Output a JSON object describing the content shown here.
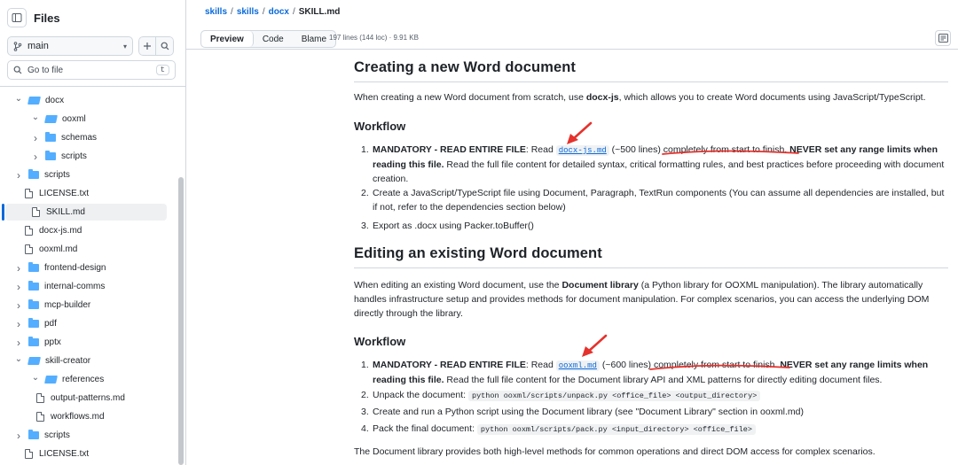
{
  "sidebar": {
    "title": "Files",
    "branch": "main",
    "search_placeholder": "Go to file",
    "search_shortcut": "t",
    "tree": [
      {
        "label": "docx",
        "type": "folder",
        "expanded": true
      },
      {
        "label": "ooxml",
        "type": "folder",
        "expanded": true
      },
      {
        "label": "schemas",
        "type": "folder",
        "expanded": false
      },
      {
        "label": "scripts",
        "type": "folder",
        "expanded": false
      },
      {
        "label": "scripts",
        "type": "folder",
        "expanded": false
      },
      {
        "label": "LICENSE.txt",
        "type": "file"
      },
      {
        "label": "SKILL.md",
        "type": "file",
        "selected": true
      },
      {
        "label": "docx-js.md",
        "type": "file"
      },
      {
        "label": "ooxml.md",
        "type": "file"
      },
      {
        "label": "frontend-design",
        "type": "folder",
        "expanded": false
      },
      {
        "label": "internal-comms",
        "type": "folder",
        "expanded": false
      },
      {
        "label": "mcp-builder",
        "type": "folder",
        "expanded": false
      },
      {
        "label": "pdf",
        "type": "folder",
        "expanded": false
      },
      {
        "label": "pptx",
        "type": "folder",
        "expanded": false
      },
      {
        "label": "skill-creator",
        "type": "folder",
        "expanded": true
      },
      {
        "label": "references",
        "type": "folder",
        "expanded": true
      },
      {
        "label": "output-patterns.md",
        "type": "file"
      },
      {
        "label": "workflows.md",
        "type": "file"
      },
      {
        "label": "scripts",
        "type": "folder",
        "expanded": false
      },
      {
        "label": "LICENSE.txt",
        "type": "file"
      }
    ]
  },
  "topbar": {
    "breadcrumb": [
      "skills",
      "skills",
      "docx",
      "SKILL.md"
    ],
    "tabs": [
      "Preview",
      "Code",
      "Blame"
    ],
    "file_meta": "197 lines (144 loc) · 9.91 KB"
  },
  "content": {
    "h_create": "Creating a new Word document",
    "p_create_1": "When creating a new Word document from scratch, use ",
    "p_create_bold": "docx-js",
    "p_create_2": ", which allows you to create Word documents using JavaScript/TypeScript.",
    "h_workflow_1": "Workflow",
    "wf1": {
      "item1_bold": "MANDATORY - READ ENTIRE FILE",
      "item1_read": ": Read ",
      "item1_link": "docx-js.md",
      "item1_after": " (~500 lines) completely from start to finish. ",
      "item1_bold2": "NEVER set any range limits when reading this file.",
      "item1_rest": " Read the full file content for detailed syntax, critical formatting rules, and best practices before proceeding with document creation.",
      "item2": "Create a JavaScript/TypeScript file using Document, Paragraph, TextRun components (You can assume all dependencies are installed, but if not, refer to the dependencies section below)",
      "item3": "Export as .docx using Packer.toBuffer()"
    },
    "h_edit": "Editing an existing Word document",
    "p_edit_1": "When editing an existing Word document, use the ",
    "p_edit_bold": "Document library",
    "p_edit_2": " (a Python library for OOXML manipulation). The library automatically handles infrastructure setup and provides methods for document manipulation. For complex scenarios, you can access the underlying DOM directly through the library.",
    "h_workflow_2": "Workflow",
    "wf2": {
      "item1_bold": "MANDATORY - READ ENTIRE FILE",
      "item1_read": ": Read ",
      "item1_link": "ooxml.md",
      "item1_after": " (~600 lines) completely from start to finish. ",
      "item1_bold2": "NEVER set any range limits when reading this file.",
      "item1_rest": " Read the full file content for the Document library API and XML patterns for directly editing document files.",
      "item2_text": "Unpack the document: ",
      "item2_code": "python ooxml/scripts/unpack.py <office_file> <output_directory>",
      "item3": "Create and run a Python script using the Document library (see \"Document Library\" section in ooxml.md)",
      "item4_text": "Pack the final document: ",
      "item4_code": "python ooxml/scripts/pack.py <input_directory> <office_file>"
    },
    "p_final": "The Document library provides both high-level methods for common operations and direct DOM access for complex scenarios."
  },
  "colors": {
    "link": "#0969da",
    "annotation": "#e5322d",
    "folder": "#54aeff"
  }
}
